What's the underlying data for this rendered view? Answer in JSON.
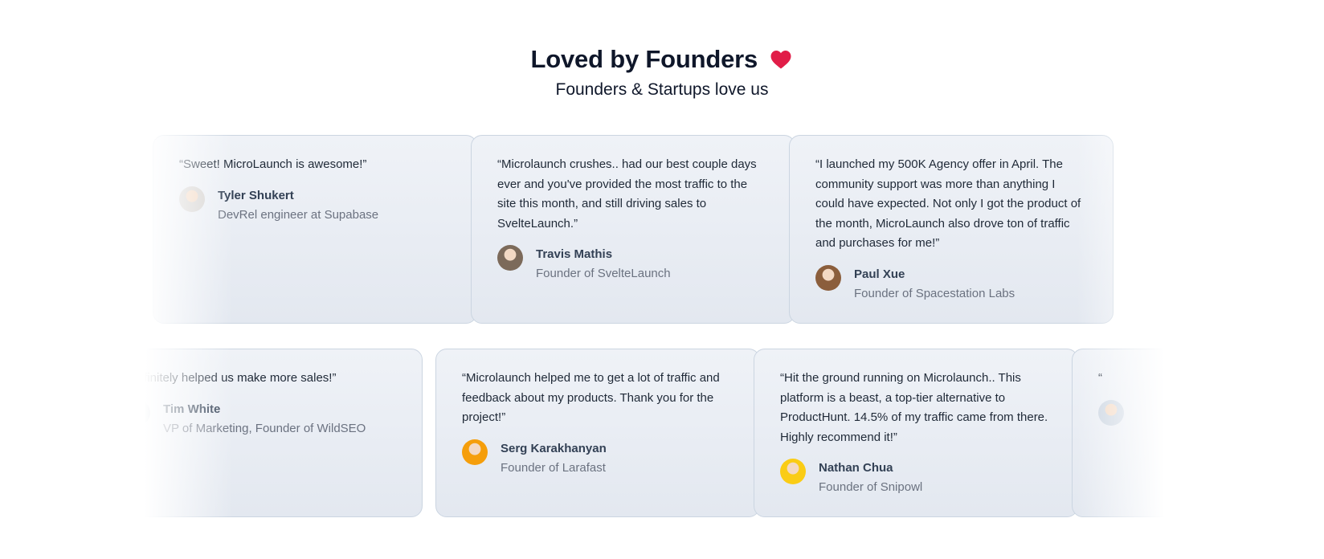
{
  "header": {
    "title": "Loved by Founders",
    "subtitle": "Founders & Startups love us",
    "heart_icon": "heart-icon",
    "heart_color": "#e11d48"
  },
  "row1": [
    {
      "quote": "“Sweet! MicroLaunch is awesome!”",
      "name": "Tyler Shukert",
      "role": "DevRel engineer at Supabase",
      "avatar_color": "#d6d3d1"
    },
    {
      "quote": "“Microlaunch crushes.. had our best couple days ever and you've provided the most traffic to the site this month, and still driving sales to SvelteLaunch.”",
      "name": "Travis Mathis",
      "role": "Founder of SvelteLaunch",
      "avatar_color": "#7c6a5a"
    },
    {
      "quote": "“I launched my 500K Agency offer in April. The community support was more than anything I could have expected. Not only I got the product of the month, MicroLaunch also drove ton of traffic and purchases for me!”",
      "name": "Paul Xue",
      "role": "Founder of Spacestation Labs",
      "avatar_color": "#8b5e3c"
    }
  ],
  "row2": [
    {
      "quote": "“Definitely helped us make more sales!”",
      "name": "Tim White",
      "role": "VP of Marketing, Founder of WildSEO",
      "avatar_color": "#94a3b8"
    },
    {
      "quote": "“Microlaunch helped me to get a lot of traffic and feedback about my products. Thank you for the project!”",
      "name": "Serg Karakhanyan",
      "role": "Founder of Larafast",
      "avatar_color": "#f59e0b"
    },
    {
      "quote": "“Hit the ground running on Microlaunch.. This platform is a beast, a top-tier alternative to ProductHunt. 14.5% of my traffic came from there. Highly recommend it!”",
      "name": "Nathan Chua",
      "role": "Founder of Snipowl",
      "avatar_color": "#facc15"
    },
    {
      "quote": "“",
      "name": "",
      "role": "",
      "avatar_color": "#cbd5e1"
    }
  ]
}
